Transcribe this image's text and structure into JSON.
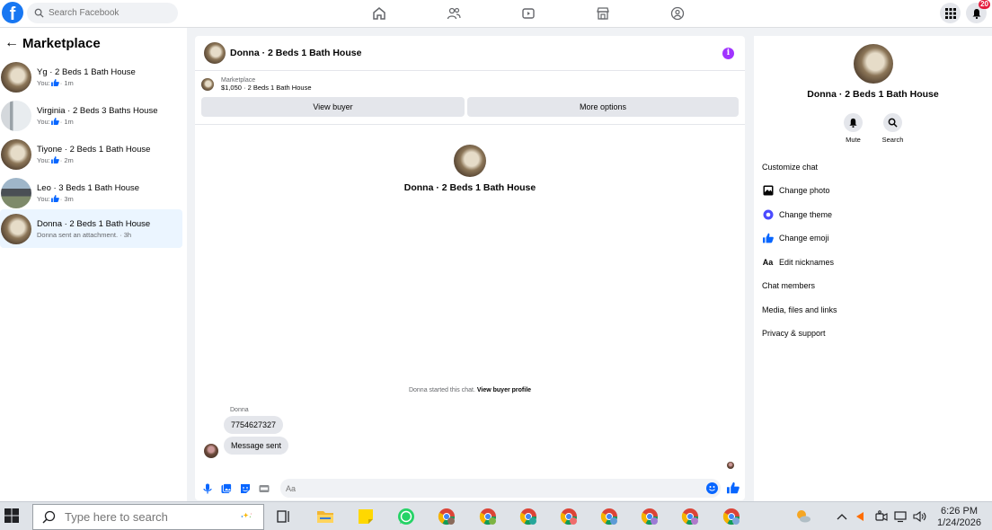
{
  "topbar": {
    "logo": "f",
    "search_placeholder": "Search Facebook",
    "notification_count": "20",
    "nav_icons": [
      "home-icon",
      "friends-icon",
      "watch-icon",
      "marketplace-icon",
      "groups-icon"
    ]
  },
  "sidebar": {
    "back_glyph": "←",
    "title": "Marketplace",
    "conversations": [
      {
        "name": "Yg · 2 Beds 1 Bath House",
        "prefix": "You:",
        "suffix": "· 1m",
        "active": false
      },
      {
        "name": "Virginia · 2 Beds 3 Baths House",
        "prefix": "You:",
        "suffix": "· 1m",
        "active": false
      },
      {
        "name": "Tiyone · 2 Beds 1 Bath House",
        "prefix": "You:",
        "suffix": "· 2m",
        "active": false
      },
      {
        "name": "Leo · 3 Beds 1 Bath House",
        "prefix": "You:",
        "suffix": "· 3m",
        "active": false
      },
      {
        "name": "Donna · 2 Beds 1 Bath House",
        "prefix": "Donna sent an attachment.",
        "suffix": "· 3h",
        "active": true
      }
    ]
  },
  "chat": {
    "title": "Donna · 2 Beds 1 Bath House",
    "info_glyph": "i",
    "listing": {
      "label": "Marketplace",
      "detail": "$1,050 · 2 Beds 1 Bath House"
    },
    "buttons": {
      "view_buyer": "View buyer",
      "more_options": "More options"
    },
    "profile_name": "Donna · 2 Beds 1 Bath House",
    "system_text": "Donna started this chat.",
    "system_link": "View buyer profile",
    "sender_name": "Donna",
    "messages": [
      "7754627327",
      "Message sent"
    ],
    "composer_placeholder": "Aa"
  },
  "details": {
    "name": "Donna · 2 Beds 1 Bath House",
    "actions": {
      "mute": "Mute",
      "search": "Search"
    },
    "items": {
      "customize": "Customize chat",
      "change_photo": "Change photo",
      "change_theme": "Change theme",
      "change_emoji": "Change emoji",
      "edit_nicknames": "Edit nicknames",
      "nickname_glyph": "Aa",
      "members": "Chat members",
      "media": "Media, files and links",
      "privacy": "Privacy & support"
    },
    "accent": "#0866ff"
  },
  "taskbar": {
    "search_placeholder": "Type here to search",
    "time": "6:26 PM",
    "date": "1/24/2026"
  }
}
